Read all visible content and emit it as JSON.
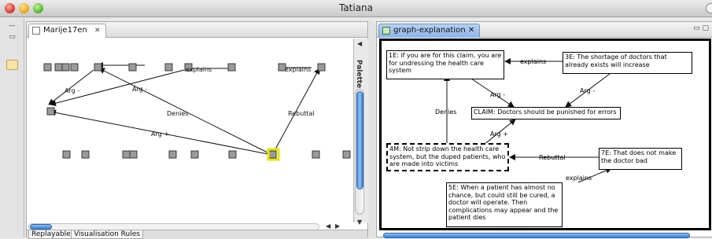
{
  "window": {
    "title": "Tatiana"
  },
  "left_editor": {
    "tab_label": "Marije17en",
    "palette_label": "Palette",
    "edge_labels": {
      "explains_1": "explains",
      "explains_2": "explains",
      "arg_minus_1": "Arg -",
      "arg_minus_2": "Arg -",
      "denies": "Denies",
      "rebuttal": "Rebuttal",
      "arg_plus": "Arg +"
    },
    "bottom_tabs": [
      "Replayable",
      "Visualisation Rules"
    ]
  },
  "right_editor": {
    "tab_label": "graph-explanation",
    "nodes": {
      "n1e": "1E: if you are for this claim, you are for undressing the health care system",
      "n3e": "3E: The shortage of doctors that already exists will increase",
      "claim": "CLAIM: Doctors should be punished for errors",
      "n4m": "4M: Not strip down the health care system, but the duped patients, who are made into victims",
      "n7e": "7E: That does not make the doctor bad",
      "n5e": "5E: When a patient has almost no chance, but could still be cured, a doctor will operate. Then complications may appear and the patient dies"
    },
    "edge_labels": {
      "explains_top": "explains",
      "arg_minus_left": "Arg -",
      "arg_minus_right": "Arg -",
      "denies": "Denies",
      "arg_plus": "Arg +",
      "rebuttal": "Rebuttal",
      "explains_bottom": "explains"
    }
  },
  "icons": [
    "close-icon",
    "grid-icon",
    "document-icon",
    "collapse-arrow-icon",
    "minimize-icon",
    "maximize-icon"
  ],
  "colors": {
    "selection": "#ffff00",
    "scroll_blue": "#3d7cc9",
    "tab_active": "#8db3e8"
  }
}
